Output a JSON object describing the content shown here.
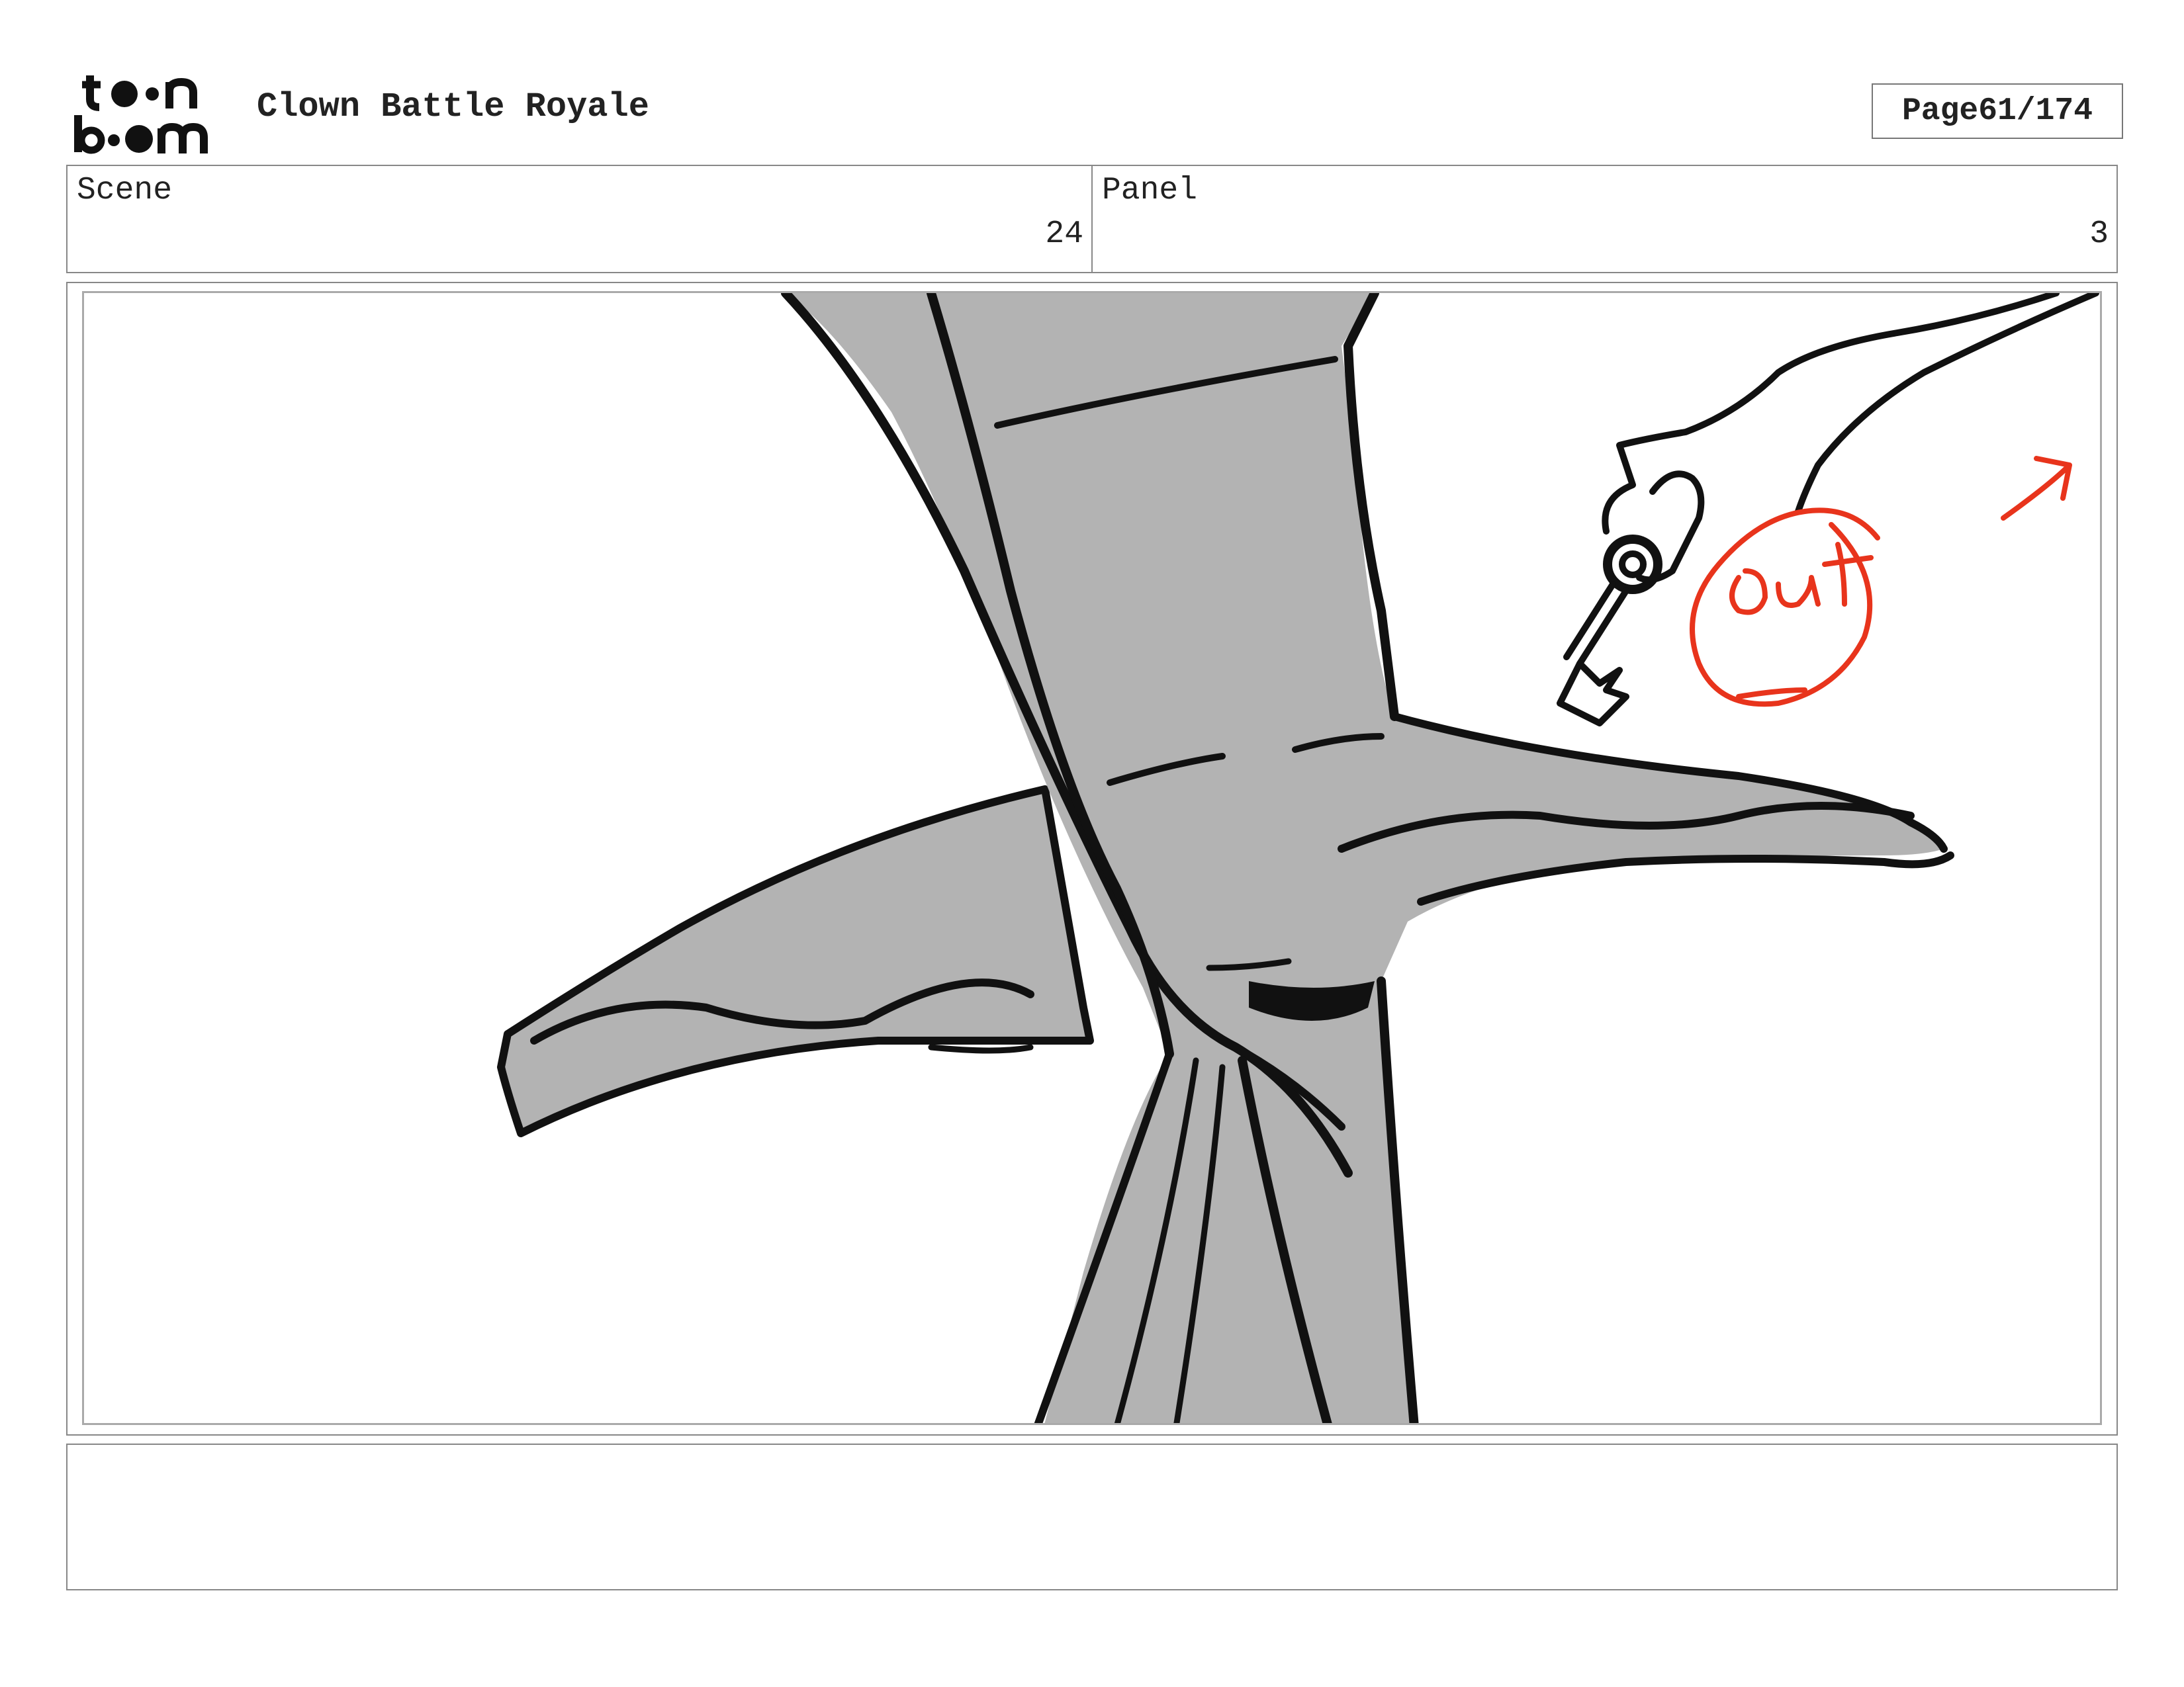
{
  "header": {
    "logo_name": "toon boom",
    "title": "Clown Battle Royale",
    "page_label": "Page",
    "page_value": "61/174"
  },
  "info": {
    "scene_label": "Scene",
    "scene_value": "24",
    "panel_label": "Panel",
    "panel_value": "3"
  },
  "drawing": {
    "annotation_text": "out",
    "annotation_color": "#e8341c",
    "fill_color": "#b3b3b3",
    "line_color": "#111111"
  },
  "notes": {
    "text": ""
  }
}
